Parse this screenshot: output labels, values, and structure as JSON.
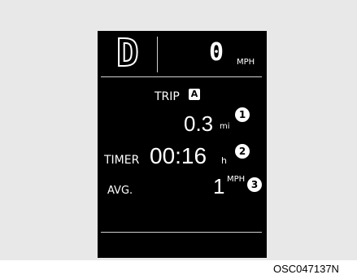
{
  "display": {
    "gear": "D",
    "speed": "0",
    "speed_unit": "MPH",
    "trip_label": "TRIP",
    "trip_badge": "A",
    "trip_distance": "0.3",
    "trip_distance_unit": "mi",
    "timer_label": "TIMER",
    "timer_value": "00:16",
    "timer_unit": "h",
    "avg_label": "AVG.",
    "avg_speed": "1",
    "avg_speed_unit": "MPH"
  },
  "markers": [
    "1",
    "2",
    "3"
  ],
  "figure_code": "OSC047137N",
  "colors": {
    "lcd_background": "#000000",
    "lcd_text": "#ffffff",
    "figure_background": "#e8e8e8"
  }
}
